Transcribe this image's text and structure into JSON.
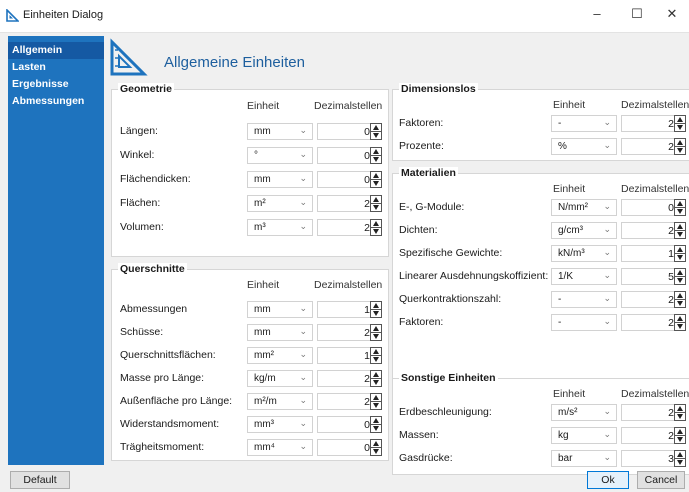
{
  "window": {
    "title": "Einheiten Dialog",
    "minimize": "–",
    "maximize": "☐",
    "close": "✕"
  },
  "sidebar": {
    "items": [
      {
        "label": "Allgemein",
        "active": true
      },
      {
        "label": "Lasten"
      },
      {
        "label": "Ergebnisse"
      },
      {
        "label": "Abmessungen"
      }
    ]
  },
  "header": {
    "title": "Allgemeine Einheiten",
    "icon": "set-square-icon"
  },
  "columns": {
    "unit": "Einheit",
    "decimals": "Dezimalstellen"
  },
  "groups": {
    "geometrie": {
      "title": "Geometrie",
      "rows": [
        {
          "label": "Längen:",
          "unit": "mm",
          "decimals": "0"
        },
        {
          "label": "Winkel:",
          "unit": "°",
          "decimals": "0"
        },
        {
          "label": "Flächendicken:",
          "unit": "mm",
          "decimals": "0"
        },
        {
          "label": "Flächen:",
          "unit": "m²",
          "decimals": "2"
        },
        {
          "label": "Volumen:",
          "unit": "m³",
          "decimals": "2"
        }
      ]
    },
    "querschnitte": {
      "title": "Querschnitte",
      "rows": [
        {
          "label": "Abmessungen",
          "unit": "mm",
          "decimals": "1"
        },
        {
          "label": "Schüsse:",
          "unit": "mm",
          "decimals": "2"
        },
        {
          "label": "Querschnittsflächen:",
          "unit": "mm²",
          "decimals": "1"
        },
        {
          "label": "Masse pro Länge:",
          "unit": "kg/m",
          "decimals": "2"
        },
        {
          "label": "Außenfläche pro Länge:",
          "unit": "m²/m",
          "decimals": "2"
        },
        {
          "label": "Widerstandsmoment:",
          "unit": "mm³",
          "decimals": "0"
        },
        {
          "label": "Trägheitsmoment:",
          "unit": "mm⁴",
          "decimals": "0"
        }
      ]
    },
    "dimensionslos": {
      "title": "Dimensionslos",
      "rows": [
        {
          "label": "Faktoren:",
          "unit": "-",
          "decimals": "2"
        },
        {
          "label": "Prozente:",
          "unit": "%",
          "decimals": "2"
        }
      ]
    },
    "materialien": {
      "title": "Materialien",
      "rows": [
        {
          "label": "E-, G-Module:",
          "unit": "N/mm²",
          "decimals": "0"
        },
        {
          "label": "Dichten:",
          "unit": "g/cm³",
          "decimals": "2"
        },
        {
          "label": "Spezifische Gewichte:",
          "unit": "kN/m³",
          "decimals": "1"
        },
        {
          "label": "Linearer Ausdehnungskoffizient:",
          "unit": "1/K",
          "decimals": "5"
        },
        {
          "label": "Querkontraktionszahl:",
          "unit": "-",
          "decimals": "2"
        },
        {
          "label": "Faktoren:",
          "unit": "-",
          "decimals": "2"
        }
      ]
    },
    "sonstige": {
      "title": "Sonstige Einheiten",
      "rows": [
        {
          "label": "Erdbeschleunigung:",
          "unit": "m/s²",
          "decimals": "2"
        },
        {
          "label": "Massen:",
          "unit": "kg",
          "decimals": "2"
        },
        {
          "label": "Gasdrücke:",
          "unit": "bar",
          "decimals": "3"
        }
      ]
    }
  },
  "footer": {
    "default": "Default",
    "ok": "Ok",
    "cancel": "Cancel"
  }
}
